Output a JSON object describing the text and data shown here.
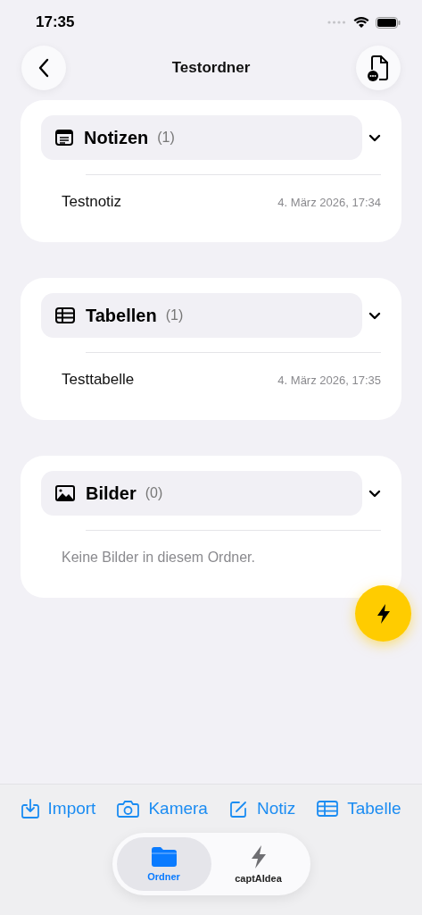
{
  "status_bar": {
    "time": "17:35"
  },
  "nav": {
    "title": "Testordner"
  },
  "sections": [
    {
      "kind": "notes",
      "title": "Notizen",
      "count": "(1)",
      "expanded": true,
      "items": [
        {
          "name": "Testnotiz",
          "date": "4. März 2026, 17:34"
        }
      ]
    },
    {
      "kind": "table",
      "title": "Tabellen",
      "count": "(1)",
      "expanded": true,
      "items": [
        {
          "name": "Testtabelle",
          "date": "4. März 2026, 17:35"
        }
      ]
    },
    {
      "kind": "image",
      "title": "Bilder",
      "count": "(0)",
      "expanded": true,
      "empty_text": "Keine Bilder in diesem Ordner."
    }
  ],
  "actions": [
    {
      "kind": "import",
      "label": "Import"
    },
    {
      "kind": "camera",
      "label": "Kamera"
    },
    {
      "kind": "note",
      "label": "Notiz"
    },
    {
      "kind": "table",
      "label": "Tabelle"
    }
  ],
  "tabs": [
    {
      "kind": "folder",
      "label": "Ordner",
      "selected": true
    },
    {
      "kind": "bolt",
      "label": "captAIdea",
      "selected": false
    }
  ]
}
